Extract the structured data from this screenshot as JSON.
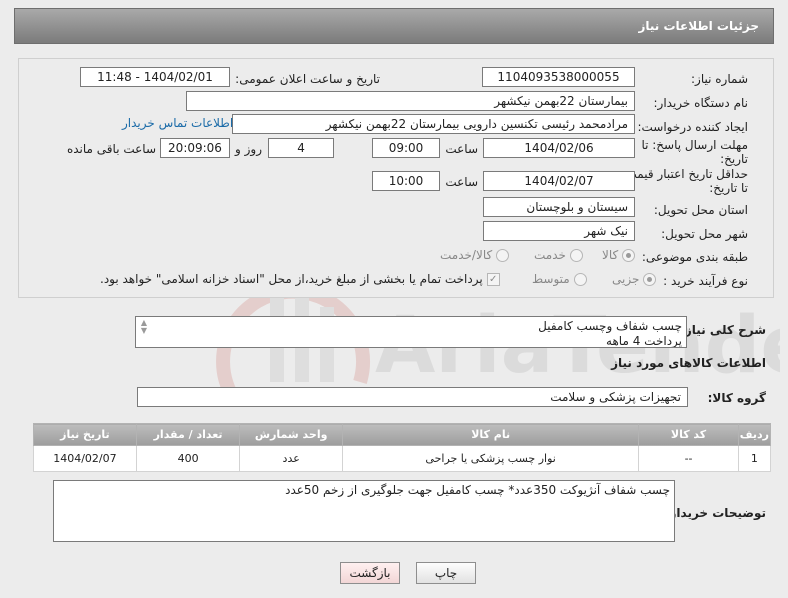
{
  "header": {
    "title": "جزئیات اطلاعات نیاز"
  },
  "form": {
    "need_number": {
      "label": "شماره نیاز:",
      "value": "1104093538000055"
    },
    "announce": {
      "label": "تاریخ و ساعت اعلان عمومی:",
      "value": "1404/02/01 - 11:48"
    },
    "buyer_org": {
      "label": "نام دستگاه خریدار:",
      "value": "بیمارستان 22بهمن نیکشهر"
    },
    "requester": {
      "label": "ایجاد کننده درخواست:",
      "value": "مرادمحمد رئیسی تکنسین دارویی بیمارستان 22بهمن نیکشهر",
      "contact_link": "اطلاعات تماس خریدار"
    },
    "reply_deadline": {
      "label_line1": "مهلت ارسال پاسخ: تا",
      "label_line2": "تاریخ:",
      "date": "1404/02/06",
      "time_label": "ساعت",
      "time": "09:00",
      "days": "4",
      "days_label": "روز و",
      "remaining": "20:09:06",
      "remaining_label": "ساعت باقی مانده"
    },
    "price_validity": {
      "label_line1": "حداقل تاریخ اعتبار قیمت:",
      "label_line2": "تا تاریخ:",
      "date": "1404/02/07",
      "time_label": "ساعت",
      "time": "10:00"
    },
    "province": {
      "label": "استان محل تحویل:",
      "value": "سیستان و بلوچستان"
    },
    "city": {
      "label": "شهر محل تحویل:",
      "value": "نیک شهر"
    },
    "category": {
      "label": "طبقه بندی موضوعی:",
      "options": [
        "کالا",
        "خدمت",
        "کالا/خدمت"
      ],
      "selected": "کالا"
    },
    "purchase_type": {
      "label": "نوع فرآیند خرید :",
      "options": [
        "جزیی",
        "متوسط"
      ],
      "selected": "جزیی",
      "payment_note": "پرداخت تمام یا بخشی از مبلغ خرید،از محل \"اسناد خزانه اسلامی\" خواهد بود."
    }
  },
  "description": {
    "label": "شرح کلی نیاز:",
    "lines": [
      "چسب شفاف وچسب کامفیل",
      "پرداخت 4 ماهه"
    ]
  },
  "goods": {
    "section_title": "اطلاعات کالاهای مورد نیاز",
    "group_label": "گروه کالا:",
    "group_value": "تجهیزات پزشکی و سلامت",
    "columns": [
      "ردیف",
      "کد کالا",
      "نام کالا",
      "واحد شمارش",
      "تعداد / مقدار",
      "تاریخ نیاز"
    ],
    "rows": [
      {
        "row": "1",
        "code": "--",
        "name": "نوار چسب پزشکی یا جراحی",
        "unit": "عدد",
        "qty": "400",
        "date": "1404/02/07"
      }
    ]
  },
  "buyer_notes": {
    "label": "توضیحات خریدار:",
    "text": "چسب شفاف آنژیوکت 350عدد* چسب کامفیل جهت جلوگیری از زخم 50عدد"
  },
  "buttons": {
    "print": "چاپ",
    "back": "بازگشت"
  },
  "colors": {
    "title_bar": "#8c8c8c",
    "link": "#1b6ba8",
    "table_header": "#a6a6a6"
  }
}
